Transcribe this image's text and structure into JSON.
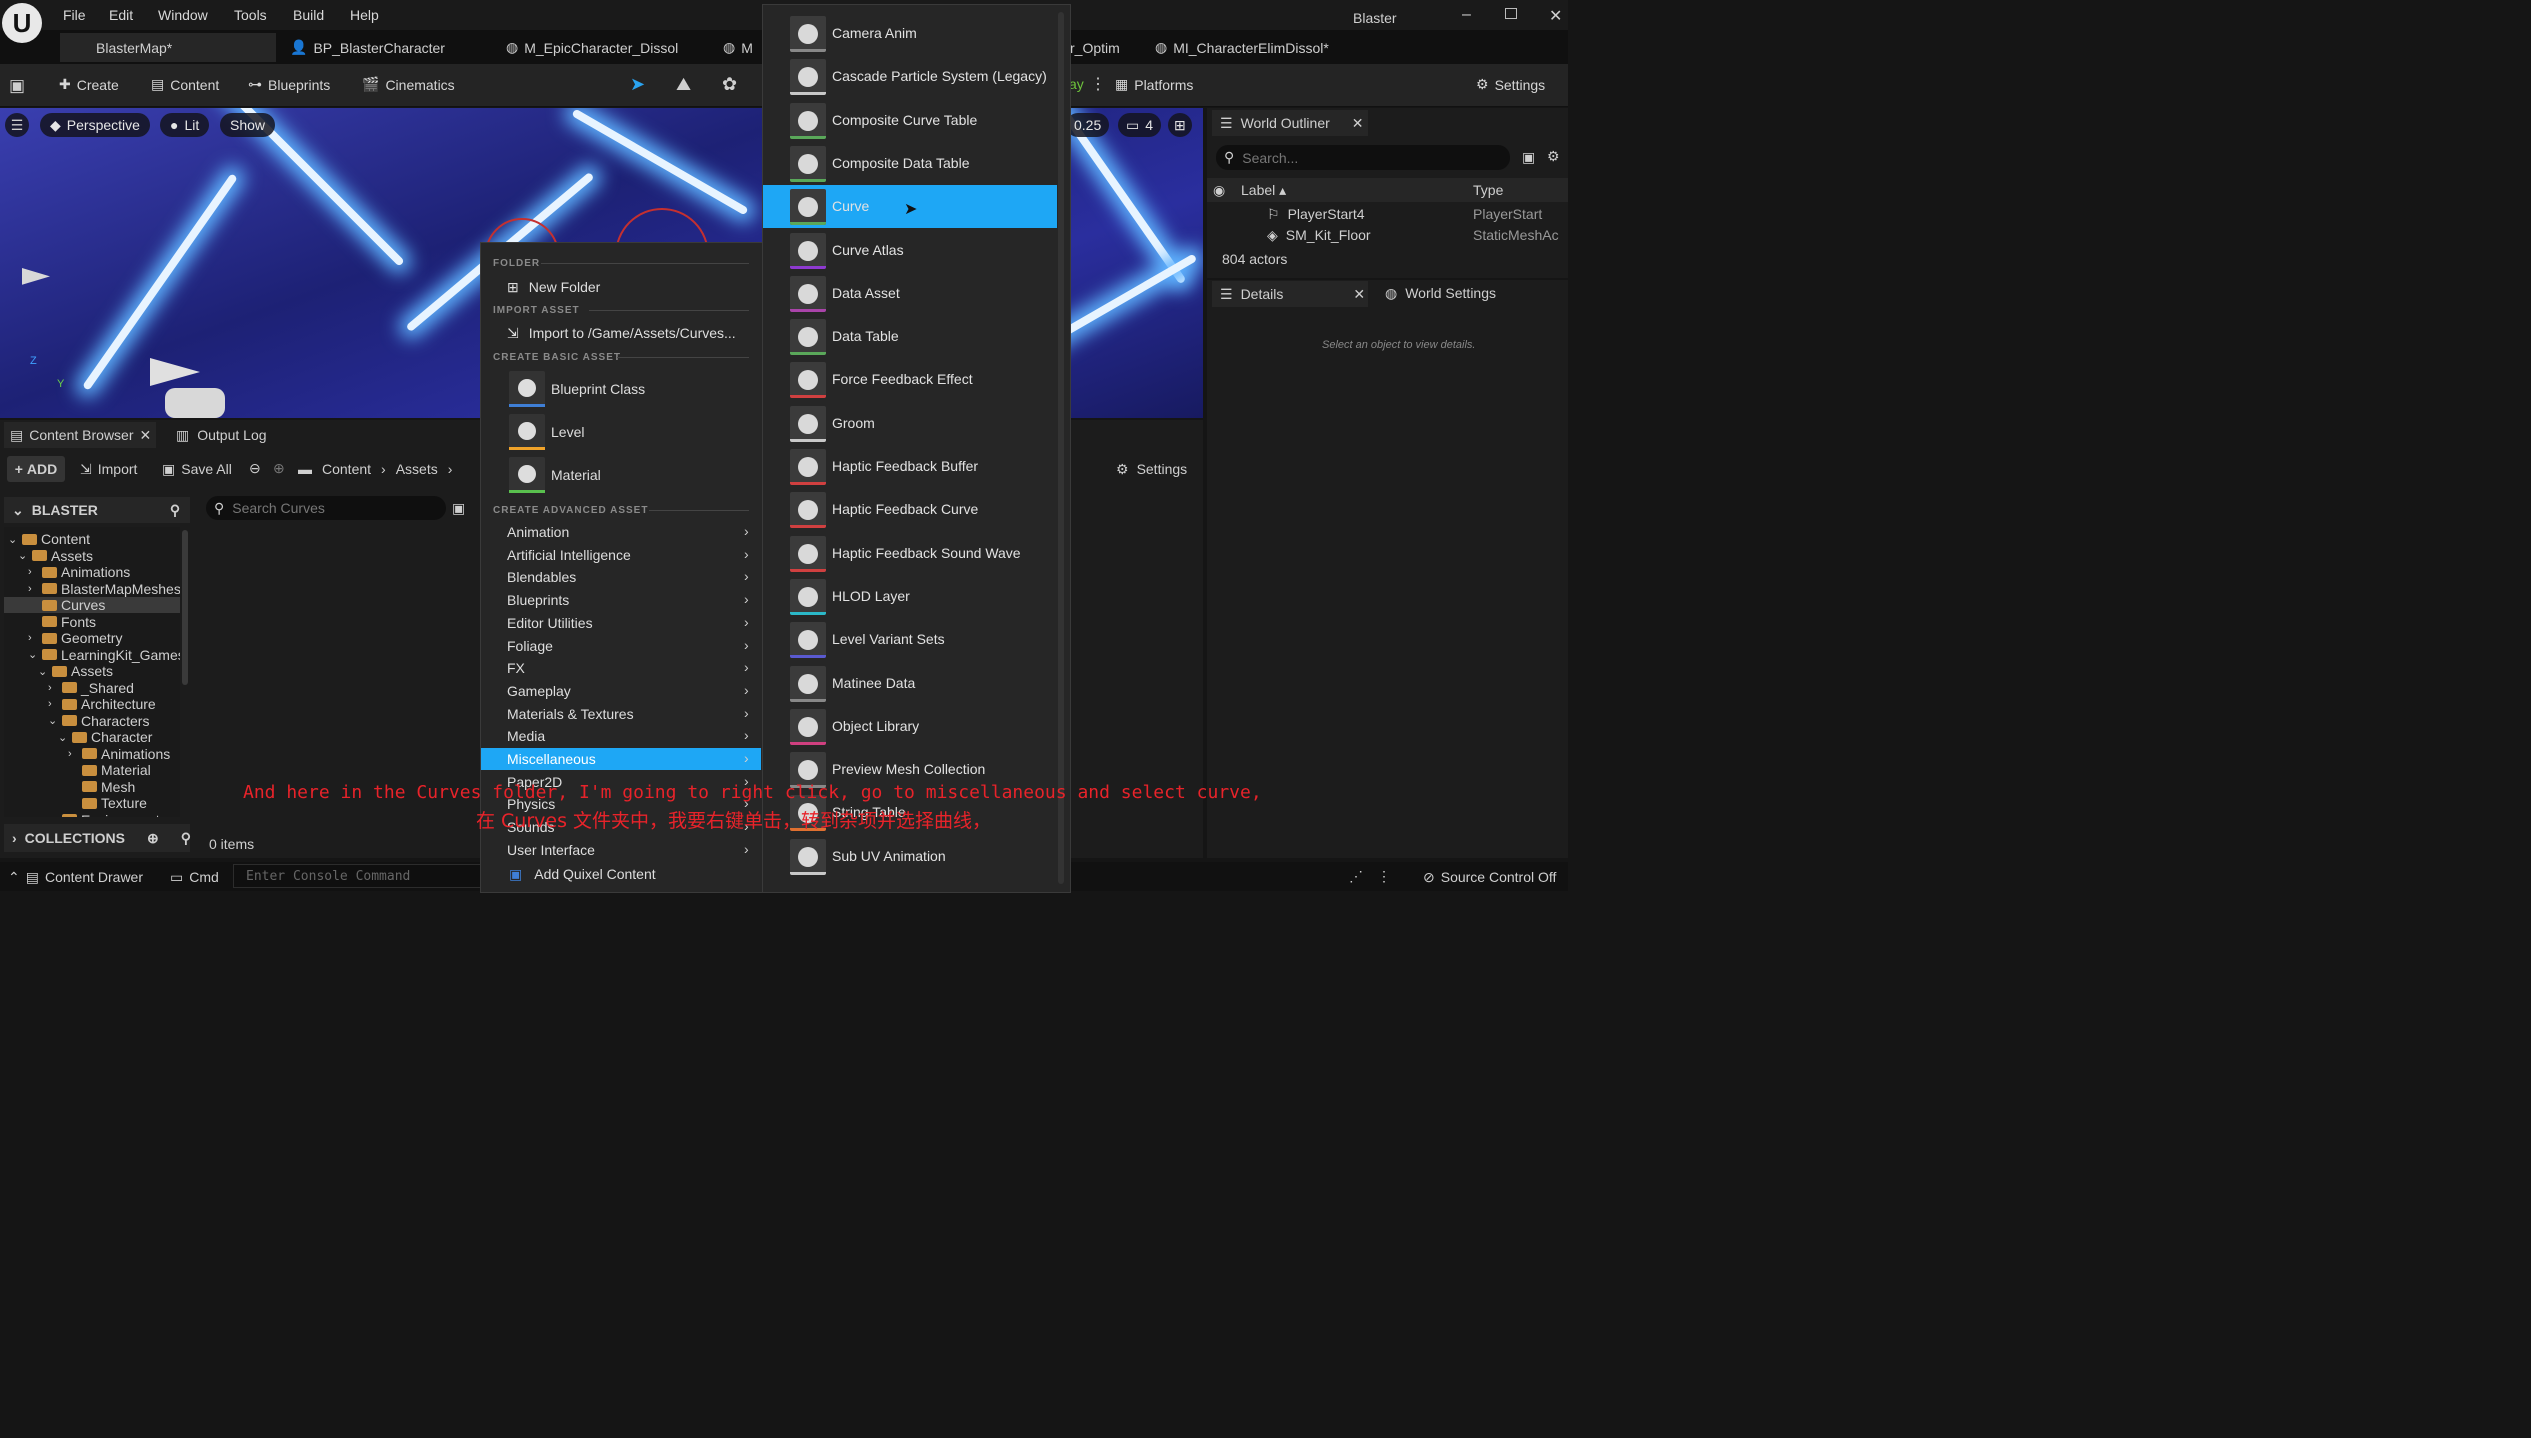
{
  "app": {
    "logo": "U",
    "window_title": "Blaster",
    "menu": [
      "File",
      "Edit",
      "Window",
      "Tools",
      "Build",
      "Help"
    ],
    "tabs": [
      "BlasterMap*",
      "BP_BlasterCharacter",
      "M_EpicCharacter_Dissol",
      "M",
      "r_Optim",
      "MI_CharacterElimDissol*"
    ]
  },
  "toolbar": {
    "create": "Create",
    "content": "Content",
    "blueprints": "Blueprints",
    "cinematics": "Cinematics",
    "play_partial": "ay",
    "platforms": "Platforms",
    "settings": "Settings"
  },
  "viewport": {
    "perspective": "Perspective",
    "lit": "Lit",
    "show": "Show",
    "snap_value": "0.25",
    "camera_speed": "4",
    "axis_z": "Z",
    "axis_y": "Y"
  },
  "outliner": {
    "title": "World Outliner",
    "search_placeholder": "Search...",
    "col_label": "Label",
    "col_type": "Type",
    "rows": [
      {
        "label": "PlayerStart4",
        "type": "PlayerStart"
      },
      {
        "label": "SM_Kit_Floor",
        "type": "StaticMeshAc"
      }
    ],
    "count": "804 actors"
  },
  "details": {
    "tab": "Details",
    "world_settings": "World Settings",
    "empty_text": "Select an object to view details."
  },
  "content_browser": {
    "tab": "Content Browser",
    "output_log": "Output Log",
    "add": "ADD",
    "import": "Import",
    "save_all": "Save All",
    "breadcrumb": [
      "Content",
      "Assets"
    ],
    "settings": "Settings",
    "root": "BLASTER",
    "search_placeholder": "Search Curves",
    "items_count": "0 items",
    "collections": "COLLECTIONS",
    "tree": [
      {
        "label": "Content",
        "indent": 0,
        "exp": "v"
      },
      {
        "label": "Assets",
        "indent": 1,
        "exp": "v"
      },
      {
        "label": "Animations",
        "indent": 2,
        "exp": ">"
      },
      {
        "label": "BlasterMapMeshes",
        "indent": 2,
        "exp": ">"
      },
      {
        "label": "Curves",
        "indent": 2,
        "exp": "",
        "selected": true
      },
      {
        "label": "Fonts",
        "indent": 2,
        "exp": ""
      },
      {
        "label": "Geometry",
        "indent": 2,
        "exp": ">"
      },
      {
        "label": "LearningKit_Games",
        "indent": 2,
        "exp": "v"
      },
      {
        "label": "Assets",
        "indent": 3,
        "exp": "v"
      },
      {
        "label": "_Shared",
        "indent": 4,
        "exp": ">"
      },
      {
        "label": "Architecture",
        "indent": 4,
        "exp": ">"
      },
      {
        "label": "Characters",
        "indent": 4,
        "exp": "v"
      },
      {
        "label": "Character",
        "indent": 5,
        "exp": "v"
      },
      {
        "label": "Animations",
        "indent": 6,
        "exp": ">"
      },
      {
        "label": "Material",
        "indent": 6,
        "exp": ""
      },
      {
        "label": "Mesh",
        "indent": 6,
        "exp": ""
      },
      {
        "label": "Texture",
        "indent": 6,
        "exp": ""
      },
      {
        "label": "Environment",
        "indent": 4,
        "exp": ">"
      }
    ]
  },
  "statusbar": {
    "content_drawer": "Content Drawer",
    "cmd": "Cmd",
    "console_placeholder": "Enter Console Command",
    "source_control": "Source Control Off"
  },
  "context_menu": {
    "sec_folder": "FOLDER",
    "new_folder": "New Folder",
    "sec_import": "IMPORT ASSET",
    "import_to": "Import to /Game/Assets/Curves...",
    "sec_basic": "CREATE BASIC ASSET",
    "basic": [
      {
        "label": "Blueprint Class",
        "color": "#3f7fd6"
      },
      {
        "label": "Level",
        "color": "#f0a32a"
      },
      {
        "label": "Material",
        "color": "#59c04e"
      }
    ],
    "sec_advanced": "CREATE ADVANCED ASSET",
    "advanced": [
      "Animation",
      "Artificial Intelligence",
      "Blendables",
      "Blueprints",
      "Editor Utilities",
      "Foliage",
      "FX",
      "Gameplay",
      "Materials & Textures",
      "Media",
      "Miscellaneous",
      "Paper2D",
      "Physics",
      "Sounds",
      "User Interface"
    ],
    "selected_advanced": "Miscellaneous",
    "quixel": "Add Quixel Content"
  },
  "submenu": {
    "items": [
      {
        "label": "Camera Anim",
        "color": "#888888",
        "icon": "camera-anim-icon"
      },
      {
        "label": "Cascade Particle System (Legacy)",
        "color": "#c8c8c8",
        "icon": "particle-icon"
      },
      {
        "label": "Composite Curve Table",
        "color": "#5aa85a",
        "icon": "composite-curve-table-icon"
      },
      {
        "label": "Composite Data Table",
        "color": "#5aa85a",
        "icon": "composite-data-table-icon"
      },
      {
        "label": "Curve",
        "color": "#5aa85a",
        "icon": "curve-icon"
      },
      {
        "label": "Curve Atlas",
        "color": "#8e3ad0",
        "icon": "curve-atlas-icon"
      },
      {
        "label": "Data Asset",
        "color": "#aa44aa",
        "icon": "data-asset-icon"
      },
      {
        "label": "Data Table",
        "color": "#5aa85a",
        "icon": "data-table-icon"
      },
      {
        "label": "Force Feedback Effect",
        "color": "#d04040",
        "icon": "force-feedback-icon"
      },
      {
        "label": "Groom",
        "color": "#c8c8c8",
        "icon": "groom-icon"
      },
      {
        "label": "Haptic Feedback Buffer",
        "color": "#d04040",
        "icon": "haptic-buffer-icon"
      },
      {
        "label": "Haptic Feedback Curve",
        "color": "#d04040",
        "icon": "haptic-curve-icon"
      },
      {
        "label": "Haptic Feedback Sound Wave",
        "color": "#d04040",
        "icon": "haptic-sound-icon"
      },
      {
        "label": "HLOD Layer",
        "color": "#2bb8c8",
        "icon": "hlod-icon"
      },
      {
        "label": "Level Variant Sets",
        "color": "#5a5ad0",
        "icon": "variant-sets-icon"
      },
      {
        "label": "Matinee Data",
        "color": "#888888",
        "icon": "matinee-icon"
      },
      {
        "label": "Object Library",
        "color": "#d04080",
        "icon": "object-library-icon"
      },
      {
        "label": "Preview Mesh Collection",
        "color": "#888888",
        "icon": "preview-mesh-icon"
      },
      {
        "label": "String Table",
        "color": "#e07030",
        "icon": "string-table-icon"
      },
      {
        "label": "Sub UV Animation",
        "color": "#c8c8c8",
        "icon": "sub-uv-icon"
      }
    ],
    "selected": "Curve"
  },
  "captions": {
    "en": "And here in the Curves folder, I'm going to right click, go to miscellaneous and select curve,",
    "zh": "在 Curves 文件夹中，我要右键单击，转到杂项并选择曲线，"
  },
  "colors": {
    "accent": "#1ea7f5",
    "caption": "#e8232a"
  }
}
